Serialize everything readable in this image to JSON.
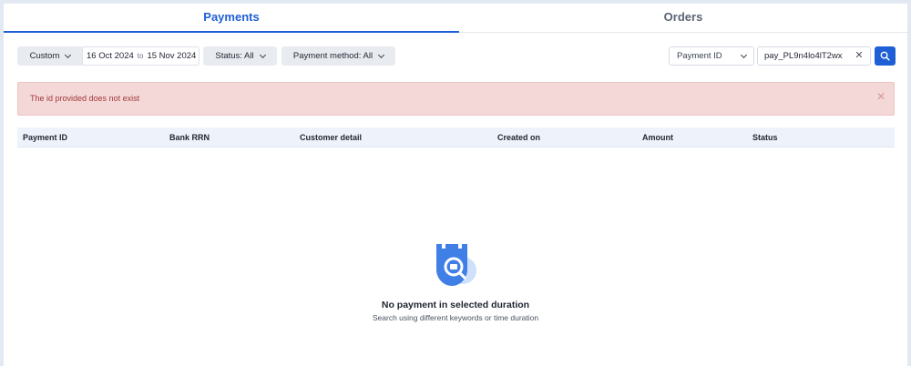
{
  "tabs": [
    {
      "label": "Payments",
      "active": true
    },
    {
      "label": "Orders",
      "active": false
    }
  ],
  "filters": {
    "range_preset": "Custom",
    "date_from": "16 Oct 2024",
    "date_to_sep": "to",
    "date_to": "15 Nov 2024",
    "status": "Status: All",
    "payment_method": "Payment method: All"
  },
  "search": {
    "type": "Payment ID",
    "value": "pay_PL9n4lo4lT2wx"
  },
  "error": {
    "message": "The id provided does not exist"
  },
  "table": {
    "columns": [
      "Payment ID",
      "Bank RRN",
      "Customer detail",
      "Created on",
      "Amount",
      "Status"
    ]
  },
  "empty_state": {
    "title": "No payment in selected duration",
    "subtitle": "Search using different keywords or time duration"
  },
  "colors": {
    "accent": "#1f5fd6",
    "error_bg": "#f4d7d7",
    "error_text": "#a13a3a",
    "header_bg": "#eef3fb"
  },
  "icons": [
    "chevron-down-icon",
    "close-icon",
    "search-icon",
    "empty-search-illustration"
  ]
}
